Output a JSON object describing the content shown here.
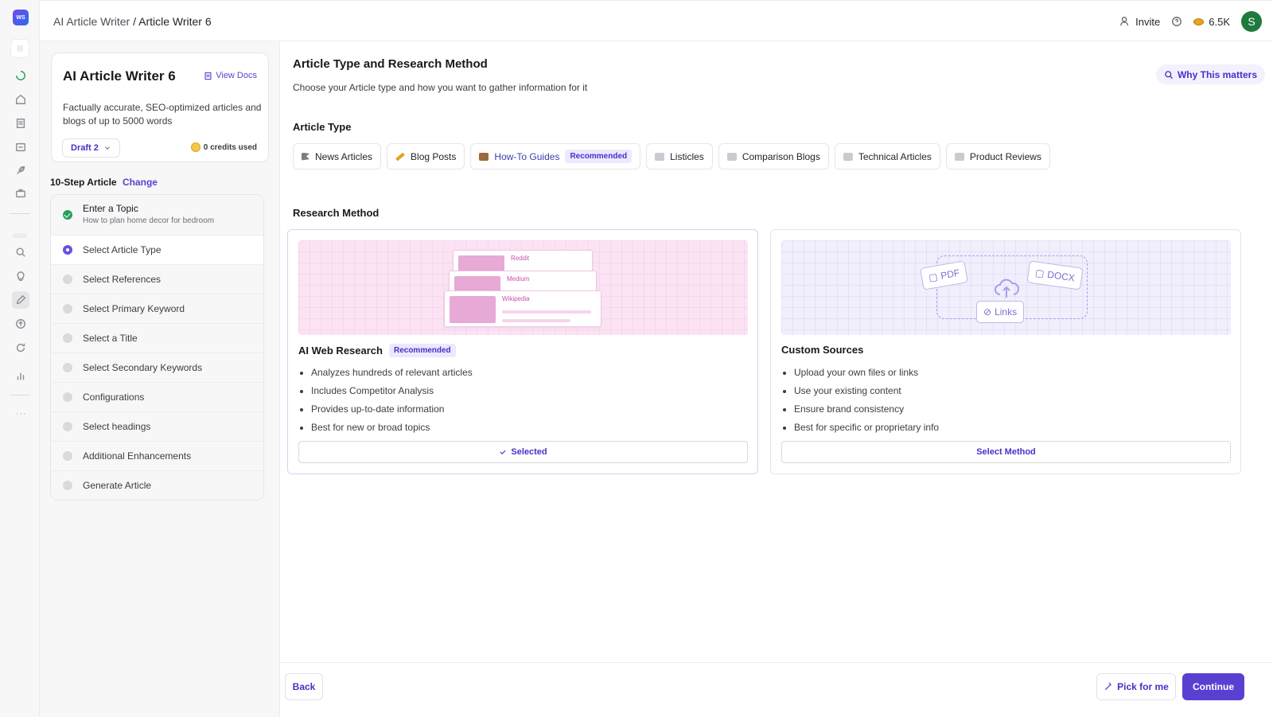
{
  "app": {
    "logo_text": "WS",
    "colors": {
      "accent": "#5b3fd1",
      "success": "#27a05a",
      "recommended_bg": "#ece8fd"
    }
  },
  "rail": {
    "icons": [
      "loading-icon",
      "home-icon",
      "document-icon",
      "image-icon",
      "feather-icon",
      "briefcase-icon",
      "search-icon",
      "lightbulb-icon",
      "pencil-icon",
      "upload-icon",
      "refresh-icon",
      "chart-icon",
      "more-icon"
    ]
  },
  "header": {
    "breadcrumb_parent": "AI Article Writer",
    "breadcrumb_sep": " / ",
    "breadcrumb_current": "Article Writer 6",
    "invite_label": "Invite",
    "credits": "6.5K",
    "avatar_initial": "S"
  },
  "sidebar": {
    "card_title": "AI Article Writer 6",
    "view_docs": "View Docs",
    "description": "Factually accurate, SEO-optimized articles and blogs of up to 5000 words",
    "draft_label": "Draft 2",
    "credits_used": "0 credits used",
    "steps_title": "10-Step Article",
    "change_label": "Change",
    "steps": [
      {
        "label": "Enter a Topic",
        "sub": "How to plan home decor for bedroom",
        "state": "done"
      },
      {
        "label": "Select Article Type",
        "state": "current"
      },
      {
        "label": "Select References",
        "state": "pending"
      },
      {
        "label": "Select Primary Keyword",
        "state": "pending"
      },
      {
        "label": "Select a Title",
        "state": "pending"
      },
      {
        "label": "Select Secondary Keywords",
        "state": "pending"
      },
      {
        "label": "Configurations",
        "state": "pending"
      },
      {
        "label": "Select headings",
        "state": "pending"
      },
      {
        "label": "Additional Enhancements",
        "state": "pending"
      },
      {
        "label": "Generate Article",
        "state": "pending"
      }
    ]
  },
  "main": {
    "title": "Article Type and Research Method",
    "subtitle": "Choose your Article type and how you want to gather information for it",
    "why_label": "Why This matters",
    "article_type_heading": "Article Type",
    "article_types": [
      {
        "label": "News Articles",
        "icon": "flag-icon"
      },
      {
        "label": "Blog Posts",
        "icon": "pencil-icon"
      },
      {
        "label": "How-To Guides",
        "icon": "book-icon",
        "badge": "Recommended",
        "selected": true
      },
      {
        "label": "Listicles",
        "icon": "envelope-icon"
      },
      {
        "label": "Comparison Blogs",
        "icon": "envelope-icon"
      },
      {
        "label": "Technical Articles",
        "icon": "envelope-icon"
      },
      {
        "label": "Product Reviews",
        "icon": "envelope-icon"
      }
    ],
    "research_heading": "Research Method",
    "methods": [
      {
        "title": "AI Web Research",
        "badge": "Recommended",
        "bullets": [
          "Analyzes hundreds of relevant articles",
          "Includes Competitor Analysis",
          "Provides up-to-date information",
          "Best for new or broad topics"
        ],
        "button": "Selected",
        "art_labels": [
          "Reddit",
          "Medium",
          "Wikipedia"
        ]
      },
      {
        "title": "Custom Sources",
        "bullets": [
          "Upload your own files or links",
          "Use your existing content",
          "Ensure brand consistency",
          "Best for specific or proprietary info"
        ],
        "button": "Select Method",
        "art_labels": [
          "PDF",
          "DOCX",
          "Links"
        ]
      }
    ]
  },
  "footer": {
    "back": "Back",
    "pick": "Pick for me",
    "continue": "Continue"
  }
}
